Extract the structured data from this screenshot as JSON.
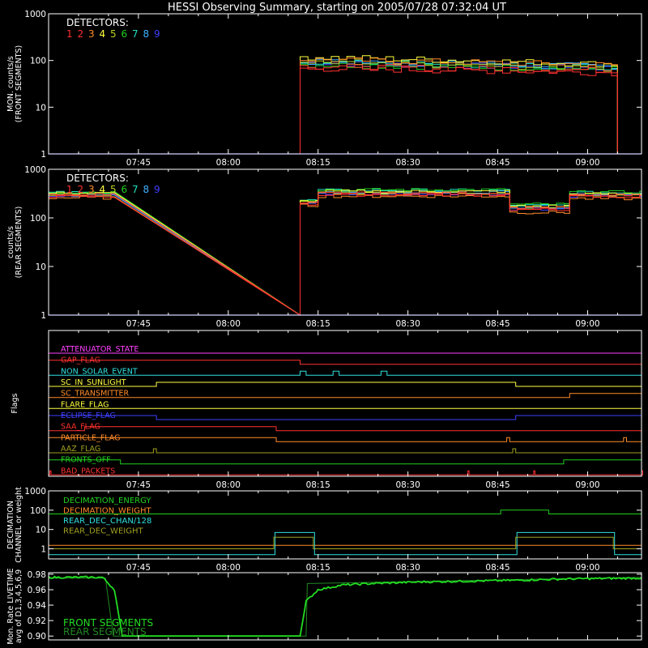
{
  "page_title": "HESSI Observing Summary, starting on 2005/07/28 07:32:04 UT",
  "x_axis": {
    "range_minutes": [
      -2,
      97
    ],
    "tick_labels": [
      "07:45",
      "08:00",
      "08:15",
      "08:30",
      "08:45",
      "09:00"
    ],
    "tick_minutes": [
      13,
      28,
      43,
      58,
      73,
      88
    ]
  },
  "colors": {
    "frame": "#ffffff",
    "detectors": [
      "#ff3030",
      "#ff3030",
      "#ff8c2a",
      "#ffff40",
      "#b9d020",
      "#20d020",
      "#20e0c0",
      "#40b0ff",
      "#4040ff"
    ],
    "front_line": "#2020ff",
    "front_segments_label": "#22dd22",
    "rear_segments_label": "#228822",
    "livetime_trace": "#22ee22"
  },
  "chart_data": [
    {
      "type": "line",
      "ylabel": [
        "MON. counts/s",
        "(FRONT SEGMENTS)"
      ],
      "ylog": true,
      "ylim": [
        1,
        1000
      ],
      "ytick_labels": [
        "1",
        "10",
        "100",
        "1000"
      ],
      "ytick_values": [
        1,
        10,
        100,
        1000
      ],
      "legend_title": "DETECTORS:",
      "legend_numbers": [
        "1",
        "2",
        "3",
        "4",
        "5",
        "6",
        "7",
        "8",
        "9"
      ],
      "legend_placement": "top-left",
      "segments": [
        [
          40,
          93
        ]
      ],
      "series_levels_start": [
        75,
        68,
        105,
        120,
        88,
        82,
        92,
        95,
        90
      ],
      "series_levels_end": [
        62,
        55,
        80,
        82,
        68,
        65,
        72,
        75,
        68
      ],
      "base_level": 1
    },
    {
      "type": "line",
      "ylabel": [
        "counts/s",
        "(REAR SEGMENTS)"
      ],
      "ylog": true,
      "ylim": [
        1,
        1000
      ],
      "ytick_labels": [
        "1",
        "10",
        "100",
        "1000"
      ],
      "ytick_values": [
        1,
        10,
        100,
        1000
      ],
      "legend_title": "DETECTORS:",
      "legend_numbers": [
        "1",
        "2",
        "3",
        "4",
        "5",
        "6",
        "7",
        "8",
        "9"
      ],
      "legend_placement": "top-left",
      "segments": [
        [
          -2,
          9
        ],
        [
          40,
          97
        ]
      ],
      "series_levels": [
        {
          "range": [
            -2,
            9
          ],
          "levels": [
            300,
            280,
            260,
            320,
            300,
            340,
            330,
            310,
            290
          ]
        },
        {
          "range": [
            40,
            43
          ],
          "levels": [
            200,
            190,
            180,
            220,
            210,
            240,
            230,
            220,
            200
          ]
        },
        {
          "range": [
            43,
            75
          ],
          "levels": [
            320,
            300,
            280,
            350,
            330,
            380,
            370,
            340,
            310
          ]
        },
        {
          "range": [
            75,
            85
          ],
          "levels": [
            160,
            150,
            130,
            175,
            165,
            190,
            180,
            170,
            155
          ]
        },
        {
          "range": [
            85,
            97
          ],
          "levels": [
            290,
            270,
            250,
            310,
            300,
            340,
            330,
            310,
            285
          ]
        }
      ]
    },
    {
      "type": "line",
      "ylabel": [
        "Flags"
      ],
      "flags": [
        {
          "name": "ATTENUATOR_STATE",
          "color": "#ff40ff",
          "on": []
        },
        {
          "name": "GAP_FLAG",
          "color": "#ff3030",
          "on": [
            [
              -2,
              40
            ]
          ]
        },
        {
          "name": "NON_SOLAR_EVENT",
          "color": "#30e0e0",
          "on": [
            [
              40,
              41
            ],
            [
              45.5,
              46.5
            ],
            [
              53.5,
              54.5
            ]
          ]
        },
        {
          "name": "SC_IN_SUNLIGHT",
          "color": "#ffff40",
          "on": [
            [
              16,
              76
            ]
          ]
        },
        {
          "name": "SC_TRANSMITTER",
          "color": "#ff8c2a",
          "on": [
            [
              85,
              97
            ]
          ]
        },
        {
          "name": "FLARE_FLAG",
          "color": "#ffff40",
          "on": []
        },
        {
          "name": "ECLIPSE_FLAG",
          "color": "#4040ff",
          "on": [
            [
              -2,
              16
            ],
            [
              76,
              97
            ]
          ]
        },
        {
          "name": "SAA_FLAG",
          "color": "#ff3030",
          "on": [
            [
              4,
              36
            ]
          ]
        },
        {
          "name": "PARTICLE_FLAG",
          "color": "#ff8c2a",
          "on": [
            [
              -2,
              36
            ],
            [
              74.5,
              75
            ],
            [
              94,
              94.5
            ]
          ]
        },
        {
          "name": "AAZ_FLAG",
          "color": "#a0a020",
          "on": [
            [
              15.5,
              16
            ],
            [
              75.5,
              76
            ]
          ]
        },
        {
          "name": "FRONTS_OFF",
          "color": "#20d020",
          "on": [
            [
              -2,
              10
            ],
            [
              84,
              97
            ]
          ]
        },
        {
          "name": "BAD_PACKETS",
          "color": "#ff3030",
          "on": [
            [
              -1.8,
              -1.6
            ],
            [
              68,
              68.2
            ],
            [
              79,
              79.2
            ],
            [
              97,
              97.2
            ]
          ]
        }
      ]
    },
    {
      "type": "line",
      "ylabel": [
        "DECIMATION",
        "CHANNEL or weight"
      ],
      "ylog": true,
      "ylim": [
        0.3,
        1000
      ],
      "ytick_labels": [
        "1",
        "10",
        "100",
        "1000"
      ],
      "ytick_values": [
        1,
        10,
        100,
        1000
      ],
      "series": [
        {
          "name": "DECIMATION_ENERGY",
          "color": "#20d020",
          "steps": [
            [
              -2,
              73.5,
              64
            ],
            [
              73.5,
              81.5,
              100
            ],
            [
              81.5,
              97,
              64
            ]
          ]
        },
        {
          "name": "DECIMATION_WEIGHT",
          "color": "#ff8c2a",
          "steps": [
            [
              -2,
              97,
              1.5
            ]
          ]
        },
        {
          "name": "REAR_DEC_CHAN/128",
          "color": "#30e0e0",
          "steps": [
            [
              -2,
              35.8,
              0.5
            ],
            [
              35.8,
              42.4,
              7
            ],
            [
              42.4,
              76.2,
              0.5
            ],
            [
              76.2,
              92.5,
              7
            ],
            [
              92.5,
              97,
              0.5
            ]
          ]
        },
        {
          "name": "REAR_DEC_WEIGHT",
          "color": "#a0a020",
          "steps": [
            [
              -2,
              35.6,
              1
            ],
            [
              35.6,
              42.2,
              4
            ],
            [
              42.2,
              76,
              1
            ],
            [
              76,
              92.3,
              4
            ],
            [
              92.3,
              97,
              1
            ]
          ]
        }
      ]
    },
    {
      "type": "line",
      "ylabel": [
        "Mon. Rate LIVETIME",
        "avg of D1,3,4,5,6,9"
      ],
      "ylim": [
        0.895,
        0.982
      ],
      "ytick_labels": [
        "0.90",
        "0.92",
        "0.94",
        "0.96",
        "0.98"
      ],
      "ytick_values": [
        0.9,
        0.92,
        0.94,
        0.96,
        0.98
      ],
      "series": [
        {
          "name": "FRONT SEGMENTS",
          "color": "#22dd22"
        },
        {
          "name": "REAR SEGMENTS",
          "color": "#228822"
        }
      ],
      "front_points": [
        [
          -2,
          0.976
        ],
        [
          7,
          0.976
        ],
        [
          9,
          0.96
        ],
        [
          10.3,
          0.9
        ],
        [
          40,
          0.9
        ],
        [
          41,
          0.945
        ],
        [
          43,
          0.96
        ],
        [
          47,
          0.966
        ],
        [
          52,
          0.968
        ],
        [
          60,
          0.97
        ],
        [
          75,
          0.972
        ],
        [
          85,
          0.974
        ],
        [
          97,
          0.975
        ]
      ],
      "rear_points": [
        [
          -2,
          0.975
        ],
        [
          7.5,
          0.975
        ],
        [
          8.8,
          0.9
        ],
        [
          41,
          0.9
        ],
        [
          41.2,
          0.968
        ],
        [
          97,
          0.976
        ]
      ]
    }
  ]
}
